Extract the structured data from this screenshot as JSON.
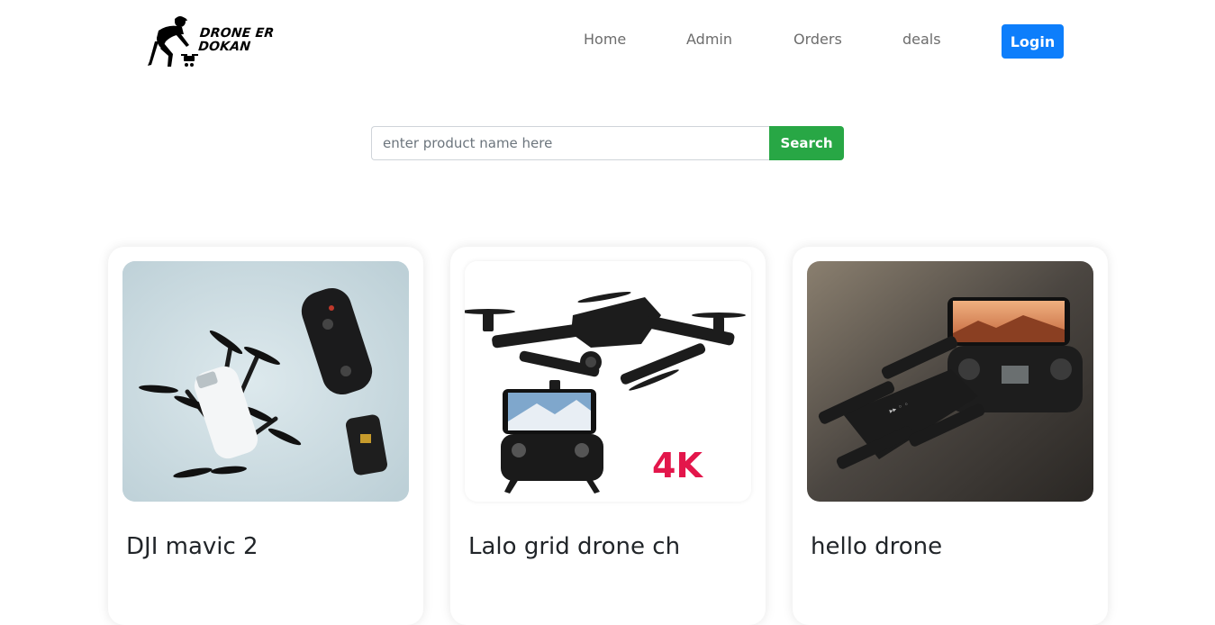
{
  "navbar": {
    "logo_text_line1": "DRONE ER",
    "logo_text_line2": "DOKAN",
    "links": [
      "Home",
      "Admin",
      "Orders",
      "deals"
    ],
    "login_label": "Login"
  },
  "search": {
    "placeholder": "enter product name here",
    "value": "",
    "button_label": "Search"
  },
  "products": [
    {
      "title": "DJI mavic 2"
    },
    {
      "title": "Lalo grid drone ch",
      "badge": "4K"
    },
    {
      "title": "hello drone"
    }
  ],
  "colors": {
    "primary": "#0d7efb",
    "success": "#28a745",
    "badge_red": "#e3164b"
  }
}
